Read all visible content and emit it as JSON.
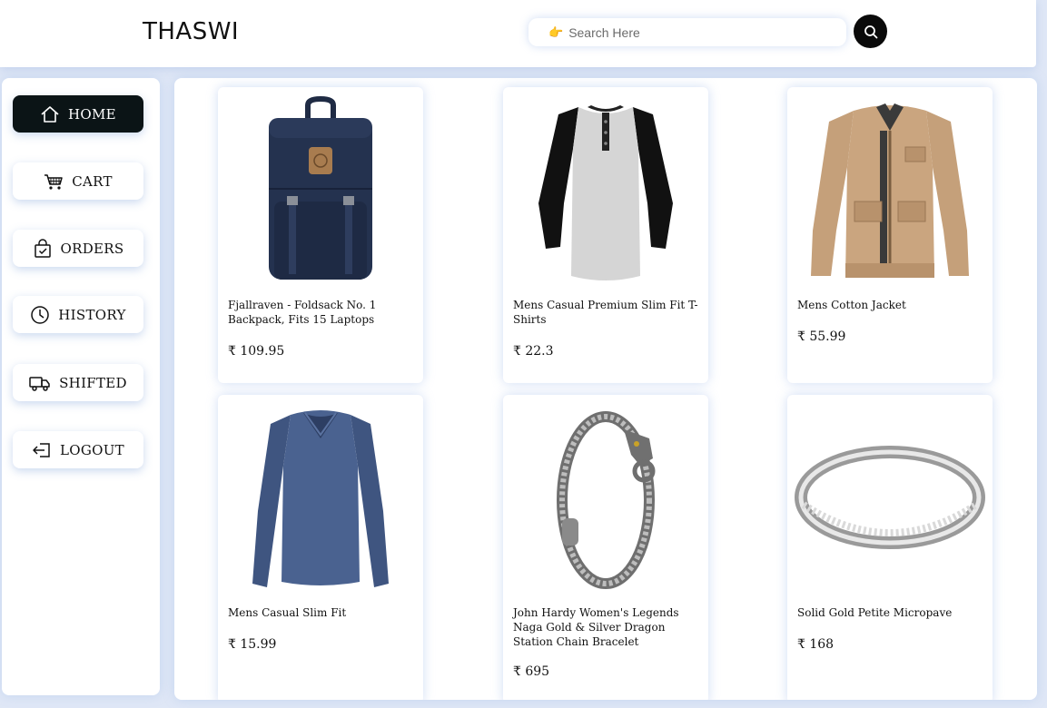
{
  "header": {
    "brand": "THASWI",
    "search_placeholder": "Search Here",
    "search_hint_icon": "pointing-hand-icon",
    "search_button_icon": "search-icon"
  },
  "sidebar": {
    "items": [
      {
        "label": "HOME",
        "icon": "home-icon",
        "active": true
      },
      {
        "label": "CART",
        "icon": "cart-icon",
        "active": false
      },
      {
        "label": "ORDERS",
        "icon": "shopping-bag-check-icon",
        "active": false
      },
      {
        "label": "HISTORY",
        "icon": "clock-icon",
        "active": false
      },
      {
        "label": "SHIFTED",
        "icon": "truck-icon",
        "active": false
      },
      {
        "label": "LOGOUT",
        "icon": "logout-icon",
        "active": false
      }
    ]
  },
  "products": [
    {
      "title": "Fjallraven - Foldsack No. 1 Backpack, Fits 15 Laptops",
      "price": "₹ 109.95",
      "image": "backpack"
    },
    {
      "title": "Mens Casual Premium Slim Fit T-Shirts",
      "price": "₹ 22.3",
      "image": "tshirt"
    },
    {
      "title": "Mens Cotton Jacket",
      "price": "₹ 55.99",
      "image": "jacket"
    },
    {
      "title": "Mens Casual Slim Fit",
      "price": "₹ 15.99",
      "image": "longsleeve"
    },
    {
      "title": "John Hardy Women's Legends Naga Gold & Silver Dragon Station Chain Bracelet",
      "price": "₹ 695",
      "image": "bracelet"
    },
    {
      "title": "Solid Gold Petite Micropave",
      "price": "₹ 168",
      "image": "ring"
    }
  ],
  "colors": {
    "accent_dark": "#0b1416",
    "background": "#dfe7f6",
    "surface": "#ffffff"
  }
}
